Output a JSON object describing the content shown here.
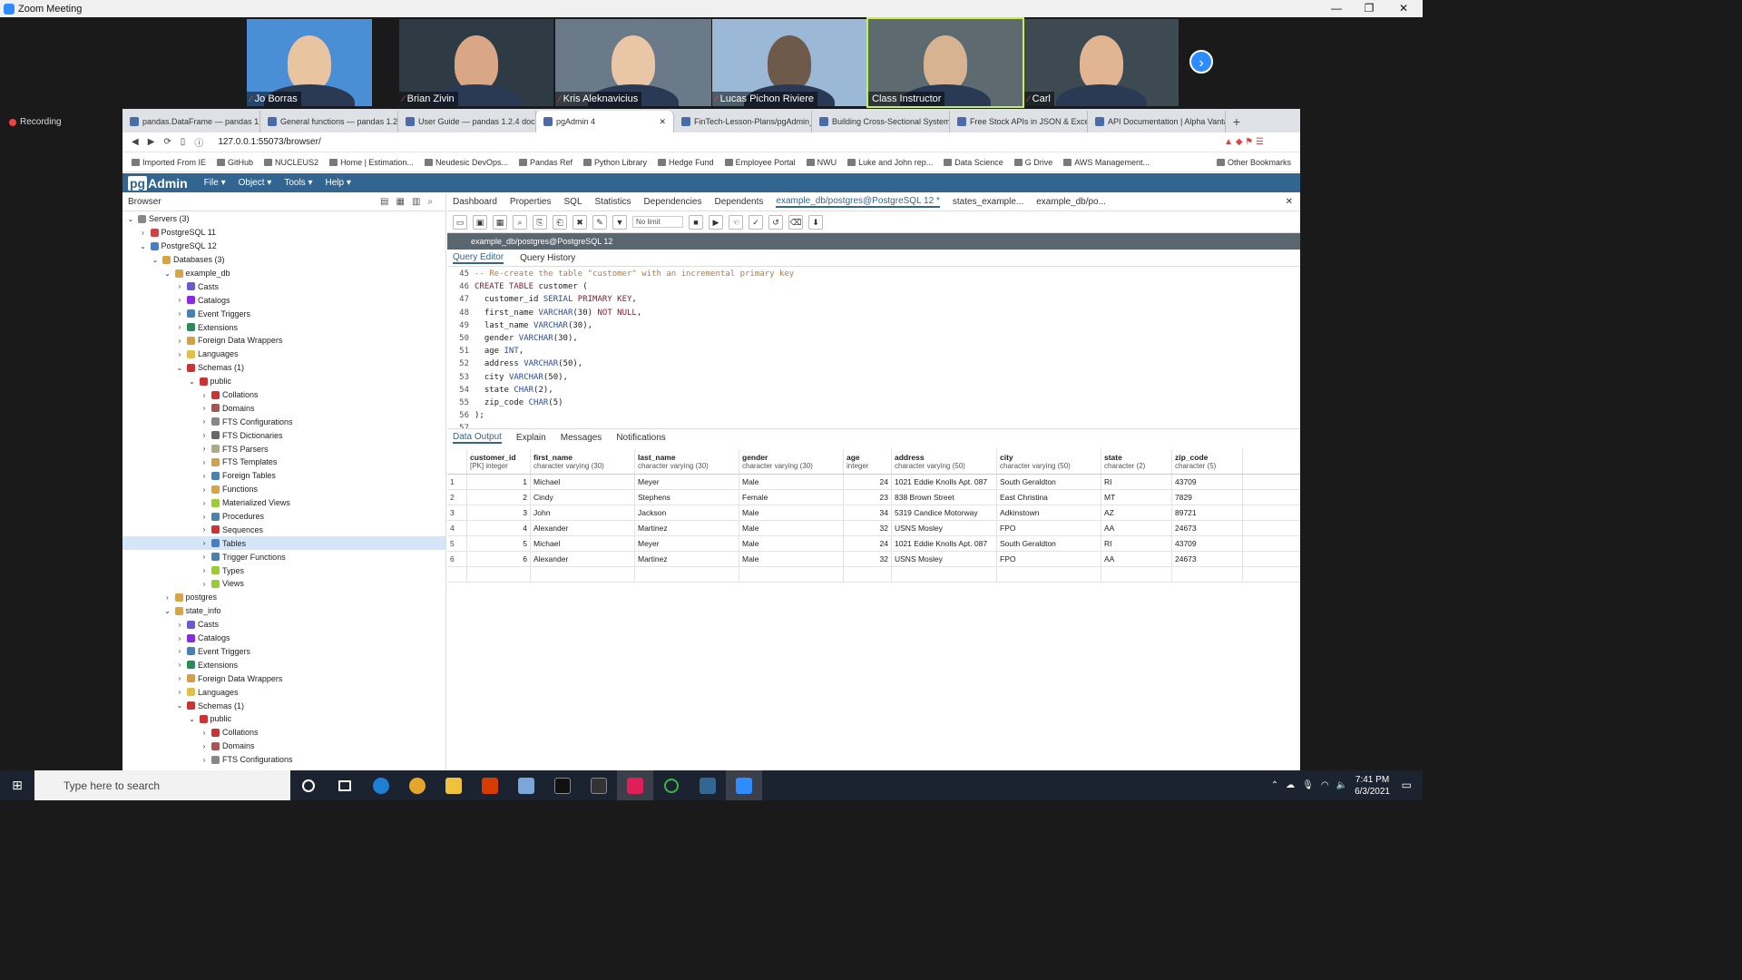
{
  "zoom": {
    "title": "Zoom Meeting",
    "recording": "Recording",
    "participants": [
      "Jo Borras",
      "Brian Zivin",
      "Kris Aleknavicius",
      "Lucas Pichon Riviere",
      "Class Instructor",
      "Carl"
    ]
  },
  "browser": {
    "tabs": [
      "pandas.DataFrame — pandas 1.2.4",
      "General functions — pandas 1.2.4",
      "User Guide — pandas 1.2.4 docum",
      "pgAdmin 4",
      "FinTech-Lesson-Plans/pgAdmin_a",
      "Building Cross-Sectional Systema",
      "Free Stock APIs in JSON & Excel |",
      "API Documentation | Alpha Vantag"
    ],
    "url": "127.0.0.1:55073/browser/",
    "bookmarks": [
      "Imported From IE",
      "GitHub",
      "NUCLEUS2",
      "Home | Estimation...",
      "Neudesic DevOps...",
      "Pandas Ref",
      "Python Library",
      "Hedge Fund",
      "Employee Portal",
      "NWU",
      "Luke and John rep...",
      "Data Science",
      "G Drive",
      "AWS Management..."
    ],
    "other_bookmarks": "Other Bookmarks"
  },
  "pgadmin": {
    "logo": "pgAdmin",
    "menu": [
      "File",
      "Object",
      "Tools",
      "Help"
    ],
    "browser_label": "Browser",
    "tree": [
      {
        "label": "Servers (3)",
        "indent": 0,
        "open": true,
        "color": "#888"
      },
      {
        "label": "PostgreSQL 11",
        "indent": 1,
        "open": false,
        "color": "#c44"
      },
      {
        "label": "PostgreSQL 12",
        "indent": 1,
        "open": true,
        "color": "#4a7ec2"
      },
      {
        "label": "Databases (3)",
        "indent": 2,
        "open": true,
        "color": "#d9a441"
      },
      {
        "label": "example_db",
        "indent": 3,
        "open": true,
        "color": "#d9a441"
      },
      {
        "label": "Casts",
        "indent": 4,
        "open": false,
        "color": "#6a5acd"
      },
      {
        "label": "Catalogs",
        "indent": 4,
        "open": false,
        "color": "#8a2be2"
      },
      {
        "label": "Event Triggers",
        "indent": 4,
        "open": false,
        "color": "#4682b4"
      },
      {
        "label": "Extensions",
        "indent": 4,
        "open": false,
        "color": "#2e8b57"
      },
      {
        "label": "Foreign Data Wrappers",
        "indent": 4,
        "open": false,
        "color": "#d2a04a"
      },
      {
        "label": "Languages",
        "indent": 4,
        "open": false,
        "color": "#e0c04a"
      },
      {
        "label": "Schemas (1)",
        "indent": 4,
        "open": true,
        "color": "#c33"
      },
      {
        "label": "public",
        "indent": 5,
        "open": true,
        "color": "#c33"
      },
      {
        "label": "Collations",
        "indent": 6,
        "open": false,
        "color": "#c33"
      },
      {
        "label": "Domains",
        "indent": 6,
        "open": false,
        "color": "#a55"
      },
      {
        "label": "FTS Configurations",
        "indent": 6,
        "open": false,
        "color": "#888"
      },
      {
        "label": "FTS Dictionaries",
        "indent": 6,
        "open": false,
        "color": "#666"
      },
      {
        "label": "FTS Parsers",
        "indent": 6,
        "open": false,
        "color": "#aa8"
      },
      {
        "label": "FTS Templates",
        "indent": 6,
        "open": false,
        "color": "#d2a04a"
      },
      {
        "label": "Foreign Tables",
        "indent": 6,
        "open": false,
        "color": "#4682b4"
      },
      {
        "label": "Functions",
        "indent": 6,
        "open": false,
        "color": "#d9a441"
      },
      {
        "label": "Materialized Views",
        "indent": 6,
        "open": false,
        "color": "#9acd32"
      },
      {
        "label": "Procedures",
        "indent": 6,
        "open": false,
        "color": "#4682b4"
      },
      {
        "label": "Sequences",
        "indent": 6,
        "open": false,
        "color": "#c33"
      },
      {
        "label": "Tables",
        "indent": 6,
        "open": false,
        "color": "#4a7ec2",
        "selected": true
      },
      {
        "label": "Trigger Functions",
        "indent": 6,
        "open": false,
        "color": "#4682b4"
      },
      {
        "label": "Types",
        "indent": 6,
        "open": false,
        "color": "#9acd32"
      },
      {
        "label": "Views",
        "indent": 6,
        "open": false,
        "color": "#9acd32"
      },
      {
        "label": "postgres",
        "indent": 3,
        "open": false,
        "color": "#d9a441"
      },
      {
        "label": "state_info",
        "indent": 3,
        "open": true,
        "color": "#d9a441"
      },
      {
        "label": "Casts",
        "indent": 4,
        "open": false,
        "color": "#6a5acd"
      },
      {
        "label": "Catalogs",
        "indent": 4,
        "open": false,
        "color": "#8a2be2"
      },
      {
        "label": "Event Triggers",
        "indent": 4,
        "open": false,
        "color": "#4682b4"
      },
      {
        "label": "Extensions",
        "indent": 4,
        "open": false,
        "color": "#2e8b57"
      },
      {
        "label": "Foreign Data Wrappers",
        "indent": 4,
        "open": false,
        "color": "#d2a04a"
      },
      {
        "label": "Languages",
        "indent": 4,
        "open": false,
        "color": "#e0c04a"
      },
      {
        "label": "Schemas (1)",
        "indent": 4,
        "open": true,
        "color": "#c33"
      },
      {
        "label": "public",
        "indent": 5,
        "open": true,
        "color": "#c33"
      },
      {
        "label": "Collations",
        "indent": 6,
        "open": false,
        "color": "#c33"
      },
      {
        "label": "Domains",
        "indent": 6,
        "open": false,
        "color": "#a55"
      },
      {
        "label": "FTS Configurations",
        "indent": 6,
        "open": false,
        "color": "#888"
      }
    ],
    "top_tabs": [
      "Dashboard",
      "Properties",
      "SQL",
      "Statistics",
      "Dependencies",
      "Dependents",
      "example_db/postgres@PostgreSQL 12 *",
      "states_example...",
      "example_db/po..."
    ],
    "no_limit": "No limit",
    "connection": "example_db/postgres@PostgreSQL 12",
    "qe_tabs": [
      "Query Editor",
      "Query History"
    ],
    "code_lines": [
      {
        "n": "45",
        "t": "-- Re-create the table \"customer\" with an incremental primary key"
      },
      {
        "n": "46",
        "t": "CREATE TABLE customer ("
      },
      {
        "n": "47",
        "t": "  customer_id SERIAL PRIMARY KEY,"
      },
      {
        "n": "48",
        "t": "  first_name VARCHAR(30) NOT NULL,"
      },
      {
        "n": "49",
        "t": "  last_name VARCHAR(30),"
      },
      {
        "n": "50",
        "t": "  gender VARCHAR(30),"
      },
      {
        "n": "51",
        "t": "  age INT,"
      },
      {
        "n": "52",
        "t": "  address VARCHAR(50),"
      },
      {
        "n": "53",
        "t": "  city VARCHAR(50),"
      },
      {
        "n": "54",
        "t": "  state CHAR(2),"
      },
      {
        "n": "55",
        "t": "  zip_code CHAR(5)"
      },
      {
        "n": "56",
        "t": ");"
      },
      {
        "n": "57",
        "t": ""
      }
    ],
    "out_tabs": [
      "Data Output",
      "Explain",
      "Messages",
      "Notifications"
    ],
    "columns": [
      {
        "name": "customer_id",
        "type": "[PK] integer"
      },
      {
        "name": "first_name",
        "type": "character varying (30)"
      },
      {
        "name": "last_name",
        "type": "character varying (30)"
      },
      {
        "name": "gender",
        "type": "character varying (30)"
      },
      {
        "name": "age",
        "type": "integer"
      },
      {
        "name": "address",
        "type": "character varying (50)"
      },
      {
        "name": "city",
        "type": "character varying (50)"
      },
      {
        "name": "state",
        "type": "character (2)"
      },
      {
        "name": "zip_code",
        "type": "character (5)"
      }
    ],
    "rows": [
      [
        "1",
        "1",
        "Michael",
        "Meyer",
        "Male",
        "24",
        "1021 Eddie Knolls Apt. 087",
        "South Geraldton",
        "RI",
        "43709"
      ],
      [
        "2",
        "2",
        "Cindy",
        "Stephens",
        "Female",
        "23",
        "838 Brown Street",
        "East Christina",
        "MT",
        "7829"
      ],
      [
        "3",
        "3",
        "John",
        "Jackson",
        "Male",
        "34",
        "5319 Candice Motorway",
        "Adkinstown",
        "AZ",
        "89721"
      ],
      [
        "4",
        "4",
        "Alexander",
        "Martinez",
        "Male",
        "32",
        "USNS Mosley",
        "FPO",
        "AA",
        "24673"
      ],
      [
        "5",
        "5",
        "Michael",
        "Meyer",
        "Male",
        "24",
        "1021 Eddie Knolls Apt. 087",
        "South Geraldton",
        "RI",
        "43709"
      ],
      [
        "6",
        "6",
        "Alexander",
        "Martinez",
        "Male",
        "32",
        "USNS Mosley",
        "FPO",
        "AA",
        "24673"
      ]
    ]
  },
  "taskbar": {
    "search_placeholder": "Type here to search",
    "time": "7:41 PM",
    "date": "6/3/2021"
  }
}
